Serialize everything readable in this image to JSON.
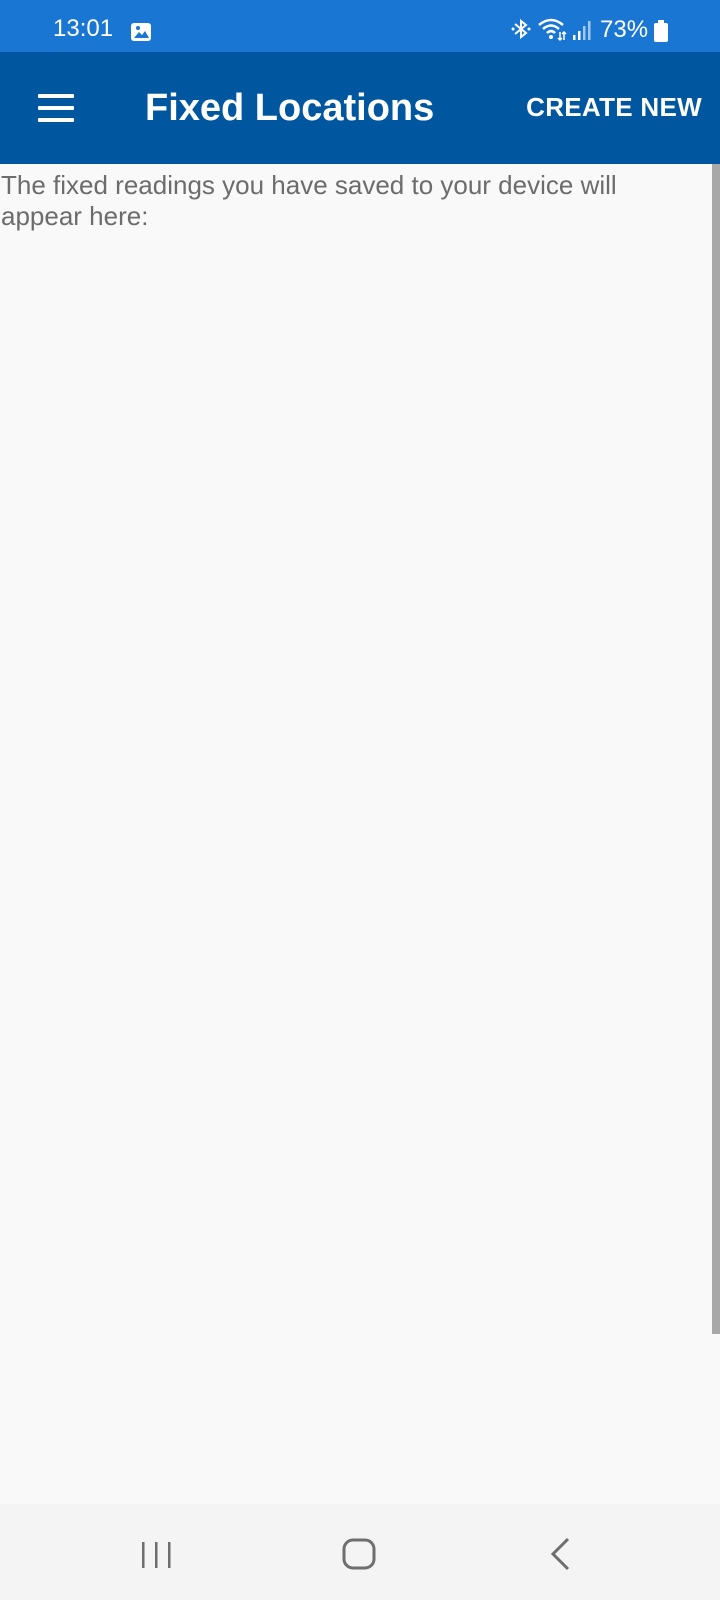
{
  "status_bar": {
    "time": "13:01",
    "battery_text": "73%",
    "icons": [
      "gallery-icon",
      "bluetooth-icon",
      "wifi-icon",
      "signal-icon",
      "battery-icon"
    ]
  },
  "app_bar": {
    "title": "Fixed Locations",
    "action_label": "CREATE NEW",
    "menu_icon": "hamburger-menu-icon"
  },
  "content": {
    "intro_text": "The fixed readings you have saved to your device will appear here:"
  },
  "nav_bar": {
    "icons": [
      "recents-icon",
      "home-icon",
      "back-icon"
    ]
  },
  "colors": {
    "status_bar": "#1976d2",
    "app_bar": "#0057a0",
    "background": "#f9f9fa",
    "text_secondary": "#6c6c6c"
  }
}
